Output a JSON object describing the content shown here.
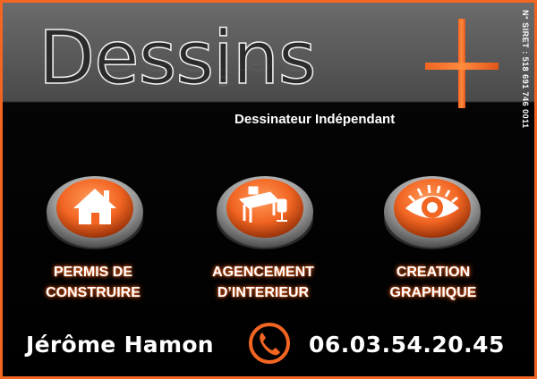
{
  "brand": {
    "name": "Dessins",
    "symbol": "+",
    "subtitle": "Dessinateur Indépendant",
    "siret": "N° SIRET : 518 691 746 0011"
  },
  "services": [
    {
      "icon": "house-icon",
      "label": "PERMIS DE\nCONSTRUIRE"
    },
    {
      "icon": "desk-icon",
      "label": "AGENCEMENT\nD’INTERIEUR"
    },
    {
      "icon": "eye-icon",
      "label": "CREATION\nGRAPHIQUE"
    }
  ],
  "contact": {
    "name": "Jérôme Hamon",
    "phone": "06.03.54.20.45",
    "phone_icon": "phone-icon"
  },
  "colors": {
    "accent": "#f26522",
    "header_gray": "#5a5a5a",
    "background": "#000000",
    "text": "#ffffff"
  }
}
